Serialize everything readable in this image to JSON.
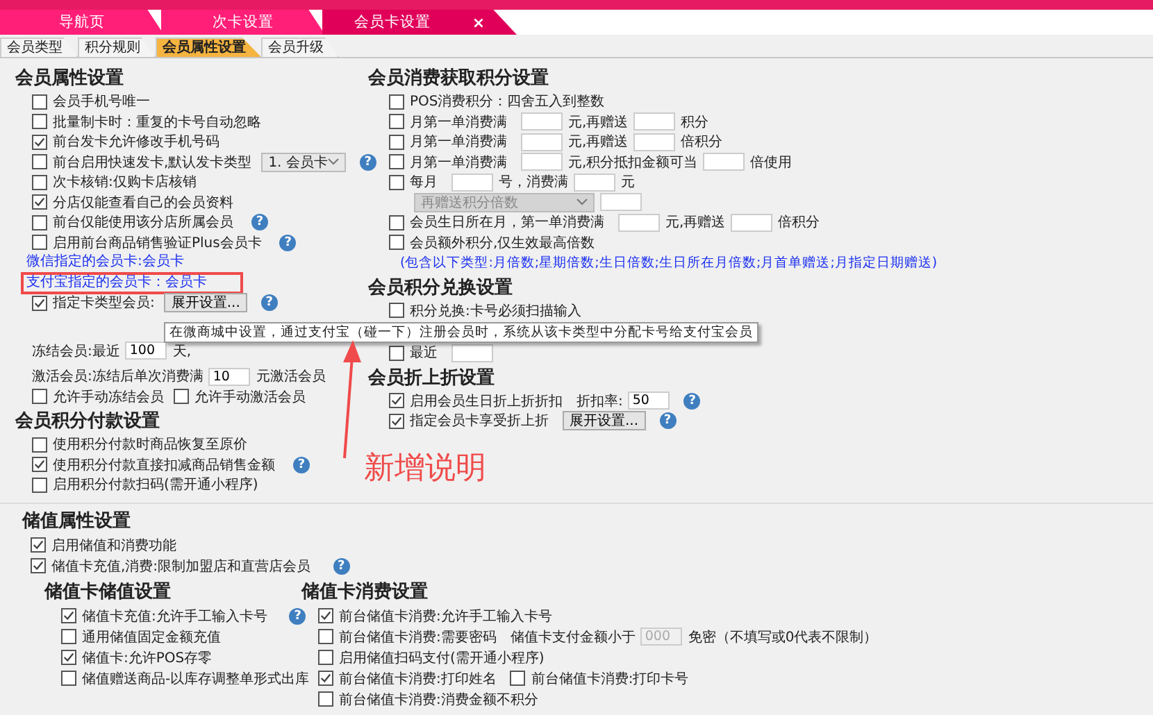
{
  "tabs": [
    {
      "label": "导航页",
      "selected": false
    },
    {
      "label": "次卡设置",
      "selected": false
    },
    {
      "label": "会员卡设置",
      "selected": true,
      "close": "×"
    }
  ],
  "sub_tabs": [
    {
      "label": "会员类型",
      "selected": false
    },
    {
      "label": "积分规则",
      "selected": false
    },
    {
      "label": "会员属性设置",
      "selected": true
    },
    {
      "label": "会员升级",
      "selected": false
    }
  ],
  "left_sections": [
    {
      "title": "会员属性设置",
      "rows": [
        {
          "parts": [
            {
              "kind": "check",
              "label": "会员手机号唯一",
              "checked": false
            }
          ]
        },
        {
          "parts": [
            {
              "kind": "check",
              "label": "批量制卡时：重复的卡号自动忽略",
              "checked": false
            }
          ]
        },
        {
          "parts": [
            {
              "kind": "check",
              "label": "前台发卡允许修改手机号码",
              "checked": true
            }
          ]
        },
        {
          "parts": [
            {
              "kind": "check",
              "label": "前台启用快速发卡,默认发卡类型",
              "checked": false
            },
            {
              "kind": "select",
              "value": "1. 会员卡",
              "disabled": false
            },
            {
              "kind": "help",
              "label": "?"
            }
          ]
        },
        {
          "parts": [
            {
              "kind": "check",
              "label": "次卡核销:仅购卡店核销",
              "checked": false
            }
          ]
        },
        {
          "parts": [
            {
              "kind": "check",
              "label": "分店仅能查看自己的会员资料",
              "checked": true
            }
          ]
        },
        {
          "parts": [
            {
              "kind": "check",
              "label": "前台仅能使用该分店所属会员",
              "checked": false
            },
            {
              "kind": "help",
              "label": "?"
            }
          ]
        },
        {
          "parts": [
            {
              "kind": "check",
              "label": "启用前台商品销售验证Plus会员卡",
              "checked": false
            },
            {
              "kind": "help",
              "label": "?"
            }
          ]
        },
        {
          "parts": [
            {
              "kind": "link",
              "text": "微信指定的会员卡:会员卡",
              "boxed": false
            }
          ]
        },
        {
          "parts": [
            {
              "kind": "link",
              "text": "支付宝指定的会员卡：会员卡",
              "boxed": true
            }
          ]
        },
        {
          "parts": [
            {
              "kind": "check",
              "label": "指定卡类型会员:",
              "checked": true
            },
            {
              "kind": "button",
              "label": "展开设置..."
            },
            {
              "kind": "help",
              "label": "?"
            }
          ]
        },
        {
          "parts": [
            {
              "kind": "text",
              "text": "冻结会员:最近"
            },
            {
              "kind": "field",
              "value": "100"
            },
            {
              "kind": "text",
              "text": "天,"
            }
          ]
        },
        {
          "parts": [
            {
              "kind": "text",
              "text": "激活会员:冻结后单次消费满"
            },
            {
              "kind": "field",
              "value": "10"
            },
            {
              "kind": "text",
              "text": "元激活会员"
            }
          ]
        },
        {
          "parts": [
            {
              "kind": "check",
              "label": "允许手动冻结会员",
              "checked": false
            },
            {
              "kind": "check",
              "label": "允许手动激活会员",
              "checked": false
            }
          ]
        }
      ]
    },
    {
      "title": "会员积分付款设置",
      "rows": [
        {
          "parts": [
            {
              "kind": "check",
              "label": "使用积分付款时商品恢复至原价",
              "checked": false
            }
          ]
        },
        {
          "parts": [
            {
              "kind": "check",
              "label": "使用积分付款直接扣减商品销售金额",
              "checked": true
            },
            {
              "kind": "help",
              "label": "?"
            }
          ]
        },
        {
          "parts": [
            {
              "kind": "check",
              "label": "启用积分付款扫码(需开通小程序)",
              "checked": false
            }
          ]
        }
      ]
    }
  ],
  "right_sections": [
    {
      "title": "会员消费获取积分设置",
      "rows": [
        {
          "parts": [
            {
              "kind": "check",
              "label": "POS消费积分：四舍五入到整数",
              "checked": false
            }
          ]
        },
        {
          "parts": [
            {
              "kind": "check",
              "label": "月第一单消费满",
              "checked": false
            },
            {
              "kind": "field"
            },
            {
              "kind": "text",
              "text": "元,再赠送"
            },
            {
              "kind": "field"
            },
            {
              "kind": "text",
              "text": "积分"
            }
          ]
        },
        {
          "parts": [
            {
              "kind": "check",
              "label": "月第一单消费满",
              "checked": false
            },
            {
              "kind": "field"
            },
            {
              "kind": "text",
              "text": "元,再赠送"
            },
            {
              "kind": "field"
            },
            {
              "kind": "text",
              "text": "倍积分"
            }
          ]
        },
        {
          "parts": [
            {
              "kind": "check",
              "label": "月第一单消费满",
              "checked": false
            },
            {
              "kind": "field"
            },
            {
              "kind": "text",
              "text": "元,积分抵扣金额可当"
            },
            {
              "kind": "field"
            },
            {
              "kind": "text",
              "text": "倍使用"
            }
          ]
        },
        {
          "parts": [
            {
              "kind": "check",
              "label": "每月",
              "checked": false
            },
            {
              "kind": "field"
            },
            {
              "kind": "text",
              "text": "号，消费满"
            },
            {
              "kind": "field"
            },
            {
              "kind": "text",
              "text": "元"
            }
          ]
        },
        {
          "parts": [
            {
              "kind": "select",
              "value": "再赠送积分倍数",
              "disabled": true
            },
            {
              "kind": "field"
            }
          ]
        },
        {
          "parts": [
            {
              "kind": "check",
              "label": "会员生日所在月，第一单消费满",
              "checked": false
            },
            {
              "kind": "field"
            },
            {
              "kind": "text",
              "text": "元,再赠送"
            },
            {
              "kind": "field"
            },
            {
              "kind": "text",
              "text": "倍积分"
            }
          ]
        },
        {
          "parts": [
            {
              "kind": "check",
              "label": "会员额外积分,仅生效最高倍数",
              "checked": false
            }
          ]
        },
        {
          "parts": [
            {
              "kind": "note",
              "text": "(包含以下类型:月倍数;星期倍数;生日倍数;生日所在月倍数;月首单赠送;月指定日期赠送)"
            }
          ]
        }
      ]
    },
    {
      "title": "会员积分兑换设置",
      "rows": [
        {
          "parts": [
            {
              "kind": "check",
              "label": "积分兑换:卡号必须扫描输入",
              "checked": false
            }
          ]
        },
        {
          "parts": [
            {
              "kind": "check",
              "label": "最近",
              "checked": false
            },
            {
              "kind": "field"
            }
          ]
        }
      ]
    },
    {
      "title": "会员折上折设置",
      "rows": [
        {
          "parts": [
            {
              "kind": "check",
              "label": "启用会员生日折上折折扣",
              "checked": true
            },
            {
              "kind": "text",
              "text": "折扣率:"
            },
            {
              "kind": "field",
              "value": "50"
            },
            {
              "kind": "help",
              "label": "?"
            }
          ]
        },
        {
          "parts": [
            {
              "kind": "check",
              "label": "指定会员卡享受折上折",
              "checked": true
            },
            {
              "kind": "button",
              "label": "展开设置..."
            },
            {
              "kind": "help",
              "label": "?"
            }
          ]
        }
      ]
    }
  ],
  "tooltip": "在微商城中设置，通过支付宝（碰一下）注册会员时，系统从该卡类型中分配卡号给支付宝会员",
  "annotation": "新增说明",
  "stored_value": {
    "title": "储值属性设置",
    "rows": [
      {
        "parts": [
          {
            "kind": "check",
            "label": "启用储值和消费功能",
            "checked": true
          }
        ]
      },
      {
        "parts": [
          {
            "kind": "check",
            "label": "储值卡充值,消费:限制加盟店和直营店会员",
            "checked": true
          },
          {
            "kind": "help",
            "label": "?"
          }
        ]
      }
    ],
    "sections": [
      {
        "title": "储值卡储值设置",
        "rows": [
          {
            "parts": [
              {
                "kind": "check",
                "label": "储值卡充值:允许手工输入卡号",
                "checked": true
              },
              {
                "kind": "help",
                "label": "?"
              }
            ]
          },
          {
            "parts": [
              {
                "kind": "check",
                "label": "通用储值固定金额充值",
                "checked": false
              }
            ]
          },
          {
            "parts": [
              {
                "kind": "check",
                "label": "储值卡:允许POS存零",
                "checked": true
              }
            ]
          },
          {
            "parts": [
              {
                "kind": "check",
                "label": "储值赠送商品-以库存调整单形式出库",
                "checked": false
              }
            ]
          }
        ]
      },
      {
        "title": "储值卡消费设置",
        "rows": [
          {
            "parts": [
              {
                "kind": "check",
                "label": "前台储值卡消费:允许手工输入卡号",
                "checked": true
              }
            ]
          },
          {
            "parts": [
              {
                "kind": "check",
                "label": "前台储值卡消费:需要密码",
                "checked": false
              },
              {
                "kind": "text",
                "text": "储值卡支付金额小于"
              },
              {
                "kind": "field",
                "placeholder": "000",
                "disabled": true
              },
              {
                "kind": "text",
                "text": "免密（不填写或0代表不限制）"
              }
            ]
          },
          {
            "parts": [
              {
                "kind": "check",
                "label": "启用储值扫码支付(需开通小程序)",
                "checked": false
              }
            ]
          },
          {
            "parts": [
              {
                "kind": "check",
                "label": "前台储值卡消费:打印姓名",
                "checked": true
              },
              {
                "kind": "check",
                "label": "前台储值卡消费:打印卡号",
                "checked": false
              }
            ]
          },
          {
            "parts": [
              {
                "kind": "check",
                "label": "前台储值卡消费:消费金额不积分",
                "checked": false
              }
            ]
          }
        ]
      }
    ]
  }
}
